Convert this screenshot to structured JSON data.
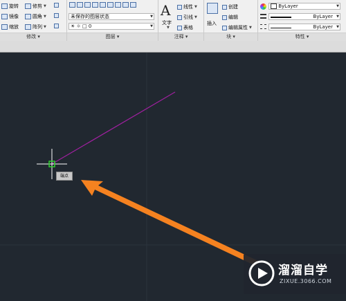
{
  "ribbon": {
    "modify": {
      "title": "修改",
      "rotate": "旋转",
      "trim": "修剪",
      "mirror": "镜像",
      "fillet": "圆角",
      "scale": "缩放",
      "array": "阵列"
    },
    "layers": {
      "title": "图层",
      "state": "未保存的图层状态",
      "current_layer": "0"
    },
    "annotation": {
      "title": "注释",
      "text": "文字",
      "linear": "线性",
      "leader": "引线",
      "table": "表格"
    },
    "block": {
      "title": "块",
      "insert": "插入",
      "create": "创建",
      "edit": "编辑",
      "edit_attributes": "编辑属性"
    },
    "properties": {
      "title": "特性",
      "color": "ByLayer",
      "linetype": "ByLayer",
      "lineweight": "ByLayer"
    }
  },
  "canvas": {
    "snap_tooltip": "端点",
    "line_color": "#a020a0",
    "snap_marker_color": "#2fd02f",
    "arrow_color": "#f58220",
    "background": "#212830"
  },
  "watermark": {
    "title": "溜溜自学",
    "url": "ZIXUE.3066.COM"
  }
}
